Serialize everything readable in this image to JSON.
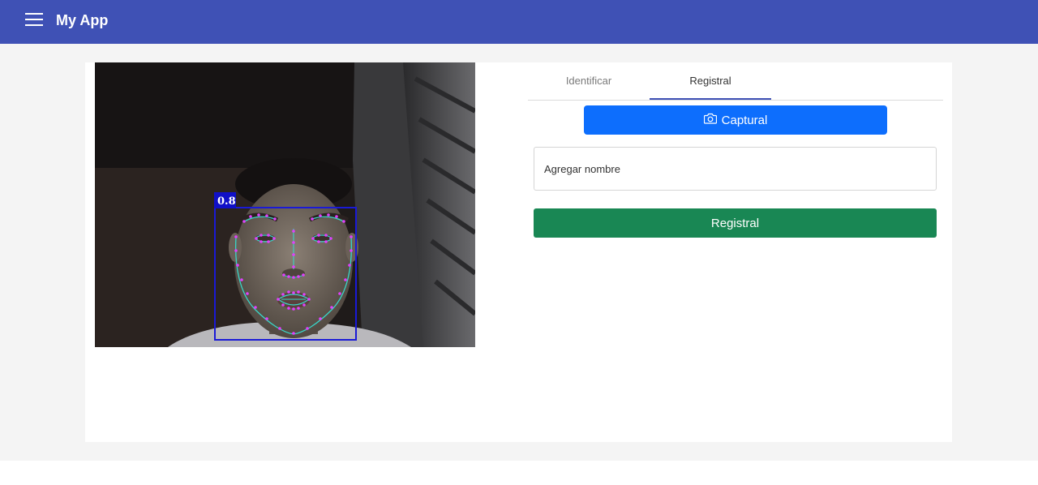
{
  "app": {
    "title": "My App",
    "menu_icon": "menu-icon"
  },
  "detection": {
    "score_label": "0.8",
    "box_color": "#1a1ad6",
    "landmark_color": "#e040fb",
    "contour_color": "#39d6c8"
  },
  "tabs": [
    {
      "label": "Identificar",
      "active": false
    },
    {
      "label": "Registral",
      "active": true
    }
  ],
  "capture_button": {
    "label": "Captural",
    "icon": "camera-icon",
    "color": "#0d6efd"
  },
  "name_input": {
    "placeholder": "Agregar nombre",
    "value": ""
  },
  "register_button": {
    "label": "Registral",
    "color": "#198754"
  },
  "colors": {
    "appbar": "#3f51b5",
    "tab_indicator": "#3f51b5"
  }
}
